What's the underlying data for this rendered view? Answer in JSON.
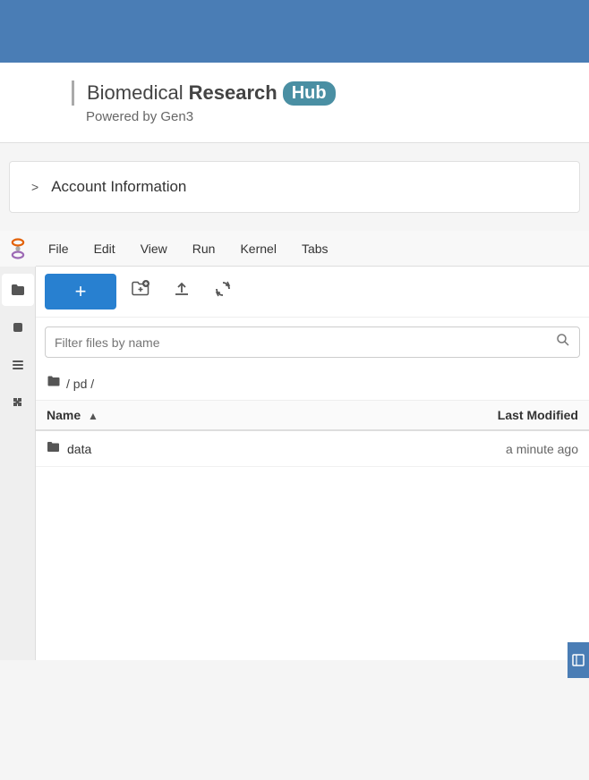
{
  "topBanner": {
    "bgColor": "#4a7db5"
  },
  "logo": {
    "separator": "|",
    "normalText": "Biomedical",
    "boldText": "Research",
    "hubBadge": "Hub",
    "poweredBy": "Powered by Gen3"
  },
  "account": {
    "chevron": ">",
    "label": "Account Information"
  },
  "menuBar": {
    "items": [
      "File",
      "Edit",
      "View",
      "Run",
      "Kernel",
      "Tabs"
    ]
  },
  "fileToolbar": {
    "newButtonLabel": "+",
    "icons": [
      {
        "name": "new-folder-icon",
        "symbol": "⊕",
        "title": "New folder"
      },
      {
        "name": "upload-icon",
        "symbol": "⬆",
        "title": "Upload"
      },
      {
        "name": "refresh-icon",
        "symbol": "↻",
        "title": "Refresh"
      }
    ]
  },
  "search": {
    "placeholder": "Filter files by name"
  },
  "breadcrumb": {
    "path": "/ pd /"
  },
  "fileTable": {
    "columns": {
      "name": "Name",
      "lastModified": "Last Modified"
    },
    "rows": [
      {
        "name": "data",
        "type": "folder",
        "lastModified": "a minute ago"
      }
    ]
  },
  "sidebarIcons": [
    {
      "name": "folder-icon",
      "symbol": "📁",
      "active": true
    },
    {
      "name": "stop-icon",
      "symbol": "⏹"
    },
    {
      "name": "list-icon",
      "symbol": "☰"
    },
    {
      "name": "puzzle-icon",
      "symbol": "🧩"
    }
  ],
  "rightPanelTab": {
    "symbol": "⧉"
  }
}
